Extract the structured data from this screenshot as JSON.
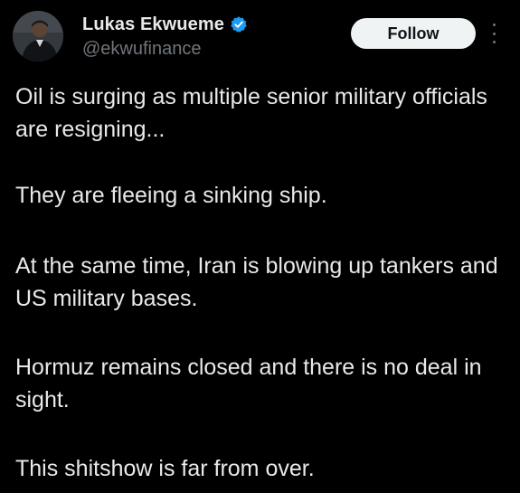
{
  "author": {
    "display_name": "Lukas Ekwueme",
    "handle": "@ekwufinance",
    "verified": true,
    "verified_color": "#1d9bf0"
  },
  "actions": {
    "follow_label": "Follow",
    "more_icon": "more-vertical-icon"
  },
  "tweet": {
    "paragraphs": [
      "Oil is surging as multiple senior military officials are resigning...",
      "They are fleeing a sinking ship.",
      "At the same time, Iran is blowing up tankers and US military bases.",
      "Hormuz remains closed and there is no deal in sight.",
      "This shitshow is far from over."
    ]
  },
  "colors": {
    "background": "#000000",
    "text": "#e7e9ea",
    "secondary_text": "#71767b",
    "button_bg": "#eff3f4"
  }
}
